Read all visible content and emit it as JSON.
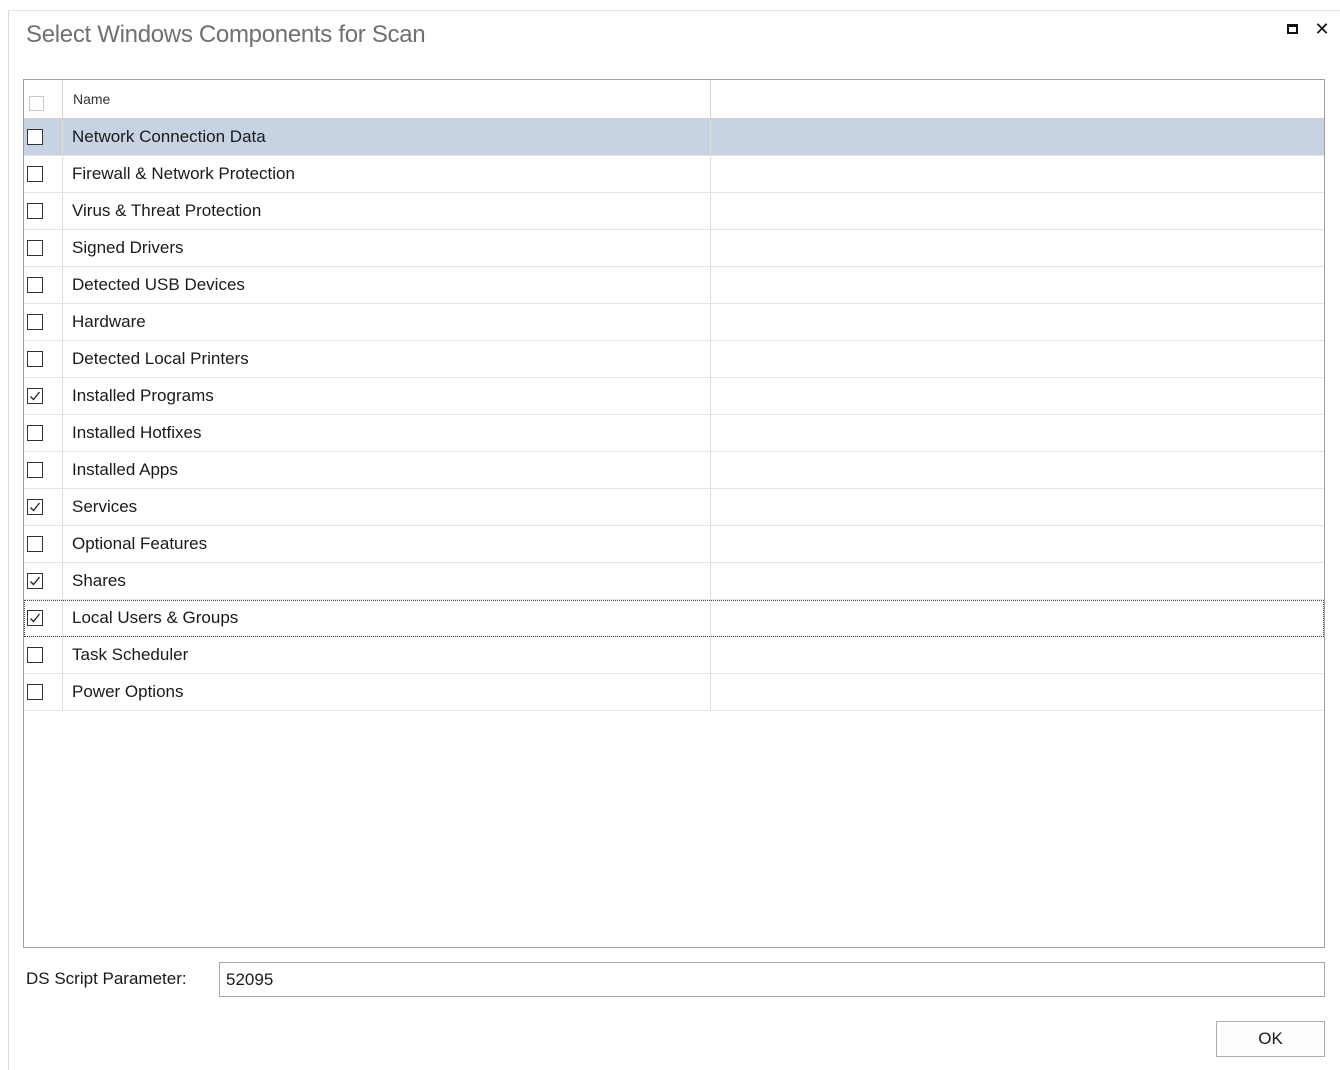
{
  "window": {
    "title": "Select Windows Components for Scan",
    "maximize_icon": "maximize-icon",
    "close_icon": "close-icon"
  },
  "grid": {
    "header": {
      "select_all_checked": false,
      "name_column": "Name"
    },
    "rows": [
      {
        "label": "Network Connection Data",
        "checked": false,
        "selected": true
      },
      {
        "label": "Firewall & Network Protection",
        "checked": false
      },
      {
        "label": "Virus & Threat Protection",
        "checked": false
      },
      {
        "label": "Signed Drivers",
        "checked": false
      },
      {
        "label": "Detected USB Devices",
        "checked": false
      },
      {
        "label": "Hardware",
        "checked": false
      },
      {
        "label": "Detected Local Printers",
        "checked": false
      },
      {
        "label": "Installed Programs",
        "checked": true
      },
      {
        "label": "Installed Hotfixes",
        "checked": false
      },
      {
        "label": "Installed Apps",
        "checked": false
      },
      {
        "label": "Services",
        "checked": true
      },
      {
        "label": "Optional Features",
        "checked": false
      },
      {
        "label": "Shares",
        "checked": true
      },
      {
        "label": "Local Users & Groups",
        "checked": true,
        "focused": true
      },
      {
        "label": "Task Scheduler",
        "checked": false
      },
      {
        "label": "Power Options",
        "checked": false
      }
    ]
  },
  "parameter": {
    "label": "DS Script Parameter:",
    "value": "52095"
  },
  "footer": {
    "ok_label": "OK"
  },
  "colors": {
    "selected_row": "#c7d3e3",
    "title_text": "#707070"
  }
}
